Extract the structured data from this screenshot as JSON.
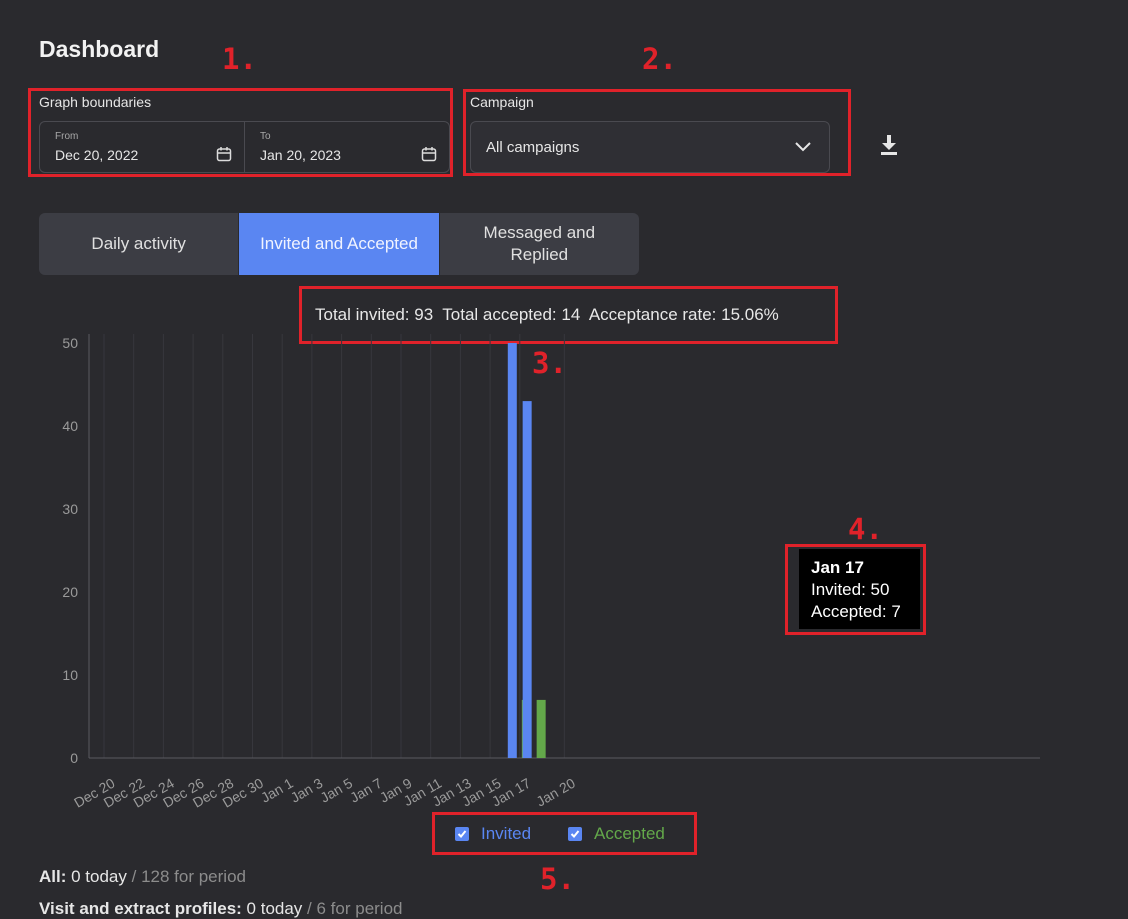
{
  "page": {
    "title": "Dashboard"
  },
  "annotations": [
    "1.",
    "2.",
    "3.",
    "4.",
    "5."
  ],
  "graph_boundaries": {
    "label": "Graph boundaries",
    "from_label": "From",
    "from_value": "Dec 20, 2022",
    "to_label": "To",
    "to_value": "Jan 20, 2023"
  },
  "campaign": {
    "label": "Campaign",
    "selected": "All campaigns"
  },
  "tabs": [
    {
      "label": "Daily activity",
      "active": false
    },
    {
      "label": "Invited and Accepted",
      "active": true
    },
    {
      "label": "Messaged and Replied",
      "active": false
    }
  ],
  "stats": {
    "invited_label": "Total invited:",
    "invited_value": "93",
    "accepted_label": "Total accepted:",
    "accepted_value": "14",
    "rate_label": "Acceptance rate:",
    "rate_value": "15.06%"
  },
  "tooltip": {
    "date": "Jan 17",
    "invited_line": "Invited: 50",
    "accepted_line": "Accepted: 7"
  },
  "legend": {
    "invited": "Invited",
    "accepted": "Accepted"
  },
  "colors": {
    "invited": "#5a86f2",
    "accepted": "#63a84a",
    "annotation": "#e0222a"
  },
  "chart_data": {
    "type": "bar",
    "x": [
      "Dec 20",
      "Dec 21",
      "Dec 22",
      "Dec 23",
      "Dec 24",
      "Dec 25",
      "Dec 26",
      "Dec 27",
      "Dec 28",
      "Dec 29",
      "Dec 30",
      "Dec 31",
      "Jan 1",
      "Jan 2",
      "Jan 3",
      "Jan 4",
      "Jan 5",
      "Jan 6",
      "Jan 7",
      "Jan 8",
      "Jan 9",
      "Jan 10",
      "Jan 11",
      "Jan 12",
      "Jan 13",
      "Jan 14",
      "Jan 15",
      "Jan 16",
      "Jan 17",
      "Jan 18",
      "Jan 19",
      "Jan 20"
    ],
    "series": [
      {
        "name": "Invited",
        "values": [
          0,
          0,
          0,
          0,
          0,
          0,
          0,
          0,
          0,
          0,
          0,
          0,
          0,
          0,
          0,
          0,
          0,
          0,
          0,
          0,
          0,
          0,
          0,
          0,
          0,
          0,
          0,
          0,
          50,
          43,
          0,
          0
        ]
      },
      {
        "name": "Accepted",
        "values": [
          0,
          0,
          0,
          0,
          0,
          0,
          0,
          0,
          0,
          0,
          0,
          0,
          0,
          0,
          0,
          0,
          0,
          0,
          0,
          0,
          0,
          0,
          0,
          0,
          0,
          0,
          0,
          0,
          7,
          7,
          0,
          0
        ]
      }
    ],
    "xtick_labels": [
      "Dec 20",
      "Dec 22",
      "Dec 24",
      "Dec 26",
      "Dec 28",
      "Dec 30",
      "Jan 1",
      "Jan 3",
      "Jan 5",
      "Jan 7",
      "Jan 9",
      "Jan 11",
      "Jan 13",
      "Jan 15",
      "Jan 17",
      "Jan 20"
    ],
    "yticks": [
      0,
      10,
      20,
      30,
      40,
      50
    ],
    "ylim": [
      0,
      50
    ],
    "grid": "vertical"
  },
  "summary": [
    {
      "label": "All:",
      "today": "0 today",
      "period": "/ 128 for period"
    },
    {
      "label": "Visit and extract profiles:",
      "today": "0 today",
      "period": "/ 6 for period"
    }
  ]
}
